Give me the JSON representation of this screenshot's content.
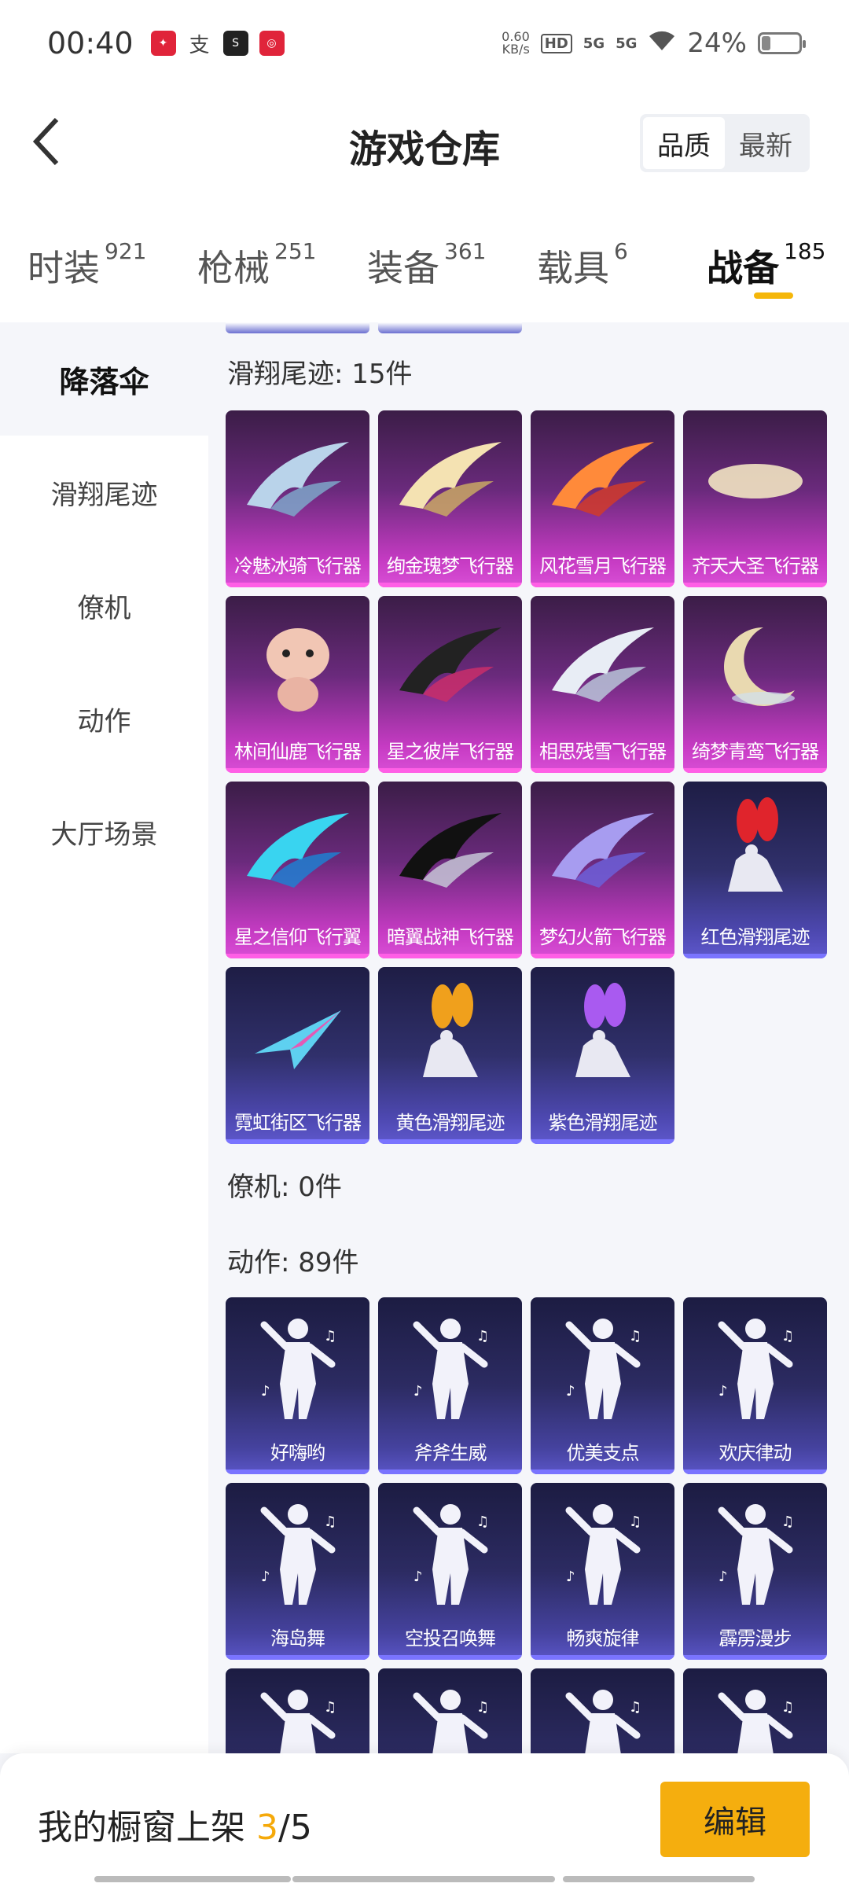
{
  "status_bar": {
    "time": "00:40",
    "net_speed_top": "0.60",
    "net_speed_bottom": "KB/s",
    "hd": "HD",
    "sig1": "5G",
    "sig2": "5G",
    "battery": "24%",
    "battery_level": 0.24
  },
  "header": {
    "title": "游戏仓库",
    "sort_quality": "品质",
    "sort_newest": "最新"
  },
  "tabs": [
    {
      "label": "时装",
      "count": "921"
    },
    {
      "label": "枪械",
      "count": "251"
    },
    {
      "label": "装备",
      "count": "361"
    },
    {
      "label": "载具",
      "count": "6"
    },
    {
      "label": "战备",
      "count": "185"
    }
  ],
  "sidebar": {
    "items": [
      {
        "label": "降落伞"
      },
      {
        "label": "滑翔尾迹"
      },
      {
        "label": "僚机"
      },
      {
        "label": "动作"
      },
      {
        "label": "大厅场景"
      }
    ]
  },
  "sections": {
    "glide_title": "滑翔尾迹: 15件",
    "wingman_title": "僚机: 0件",
    "action_title": "动作: 89件"
  },
  "glide_items": [
    {
      "name": "冷魅冰骑飞行器",
      "style": "pink"
    },
    {
      "name": "绚金瑰梦飞行器",
      "style": "pink"
    },
    {
      "name": "风花雪月飞行器",
      "style": "pink"
    },
    {
      "name": "齐天大圣飞行器",
      "style": "pink"
    },
    {
      "name": "林间仙鹿飞行器",
      "style": "pink"
    },
    {
      "name": "星之彼岸飞行器",
      "style": "pink"
    },
    {
      "name": "相思残雪飞行器",
      "style": "pink"
    },
    {
      "name": "绮梦青鸾飞行器",
      "style": "pink"
    },
    {
      "name": "星之信仰飞行翼",
      "style": "pink"
    },
    {
      "name": "暗翼战神飞行器",
      "style": "pink"
    },
    {
      "name": "梦幻火箭飞行器",
      "style": "pink"
    },
    {
      "name": "红色滑翔尾迹",
      "style": "blue"
    },
    {
      "name": "霓虹街区飞行器",
      "style": "blue"
    },
    {
      "name": "黄色滑翔尾迹",
      "style": "blue"
    },
    {
      "name": "紫色滑翔尾迹",
      "style": "blue"
    }
  ],
  "action_items": [
    {
      "name": "好嗨哟"
    },
    {
      "name": "斧斧生威"
    },
    {
      "name": "优美支点"
    },
    {
      "name": "欢庆律动"
    },
    {
      "name": "海岛舞"
    },
    {
      "name": "空投召唤舞"
    },
    {
      "name": "畅爽旋律"
    },
    {
      "name": "霹雳漫步"
    },
    {
      "name": ""
    },
    {
      "name": ""
    },
    {
      "name": ""
    },
    {
      "name": ""
    }
  ],
  "bottom": {
    "showcase_label": "我的橱窗上架 ",
    "showcase_current": "3",
    "showcase_total": "/5",
    "edit": "编辑"
  }
}
